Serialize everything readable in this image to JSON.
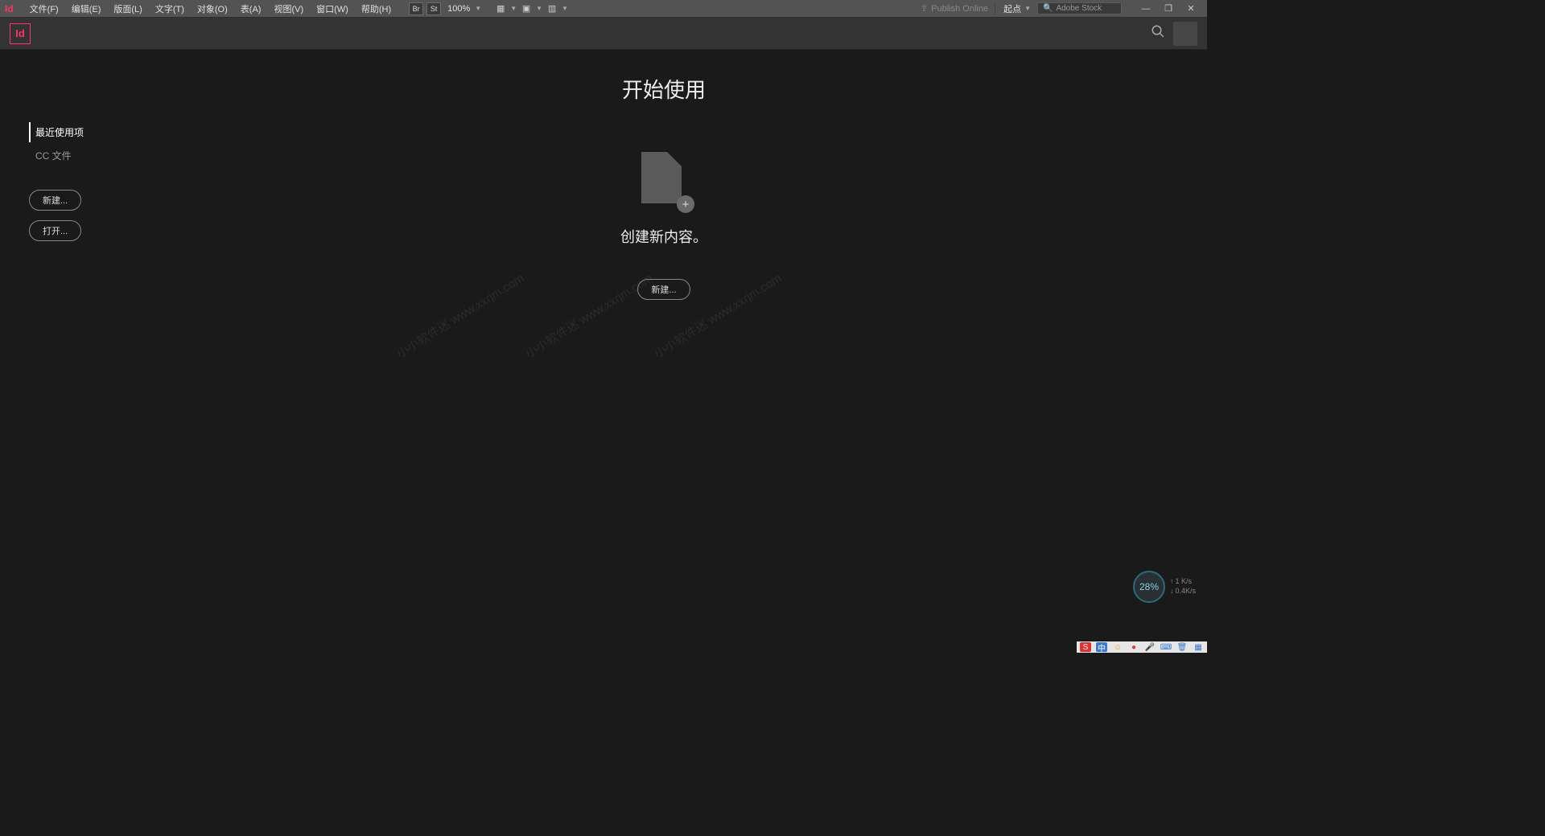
{
  "app": {
    "short": "Id",
    "logo": "Id"
  },
  "menu": {
    "file": "文件(F)",
    "edit": "编辑(E)",
    "layout": "版面(L)",
    "text": "文字(T)",
    "object": "对象(O)",
    "table": "表(A)",
    "view": "视图(V)",
    "window": "窗口(W)",
    "help": "帮助(H)"
  },
  "toolbar": {
    "br": "Br",
    "st": "St",
    "zoom": "100%"
  },
  "header_right": {
    "publish": "Publish Online",
    "workspace": "起点",
    "stock_placeholder": "Adobe Stock"
  },
  "sidebar": {
    "recent": "最近使用项",
    "cc_files": "CC 文件",
    "new_btn": "新建...",
    "open_btn": "打开..."
  },
  "main": {
    "title": "开始使用",
    "subtitle": "创建新内容。",
    "new_btn": "新建..."
  },
  "watermark": "小小软件迷 www.xxrjm.com",
  "syswidget": {
    "percent": "28%",
    "up": "1 K/s",
    "down": "0.4K/s"
  },
  "tray": {
    "sogou": "S",
    "cn": "中"
  }
}
